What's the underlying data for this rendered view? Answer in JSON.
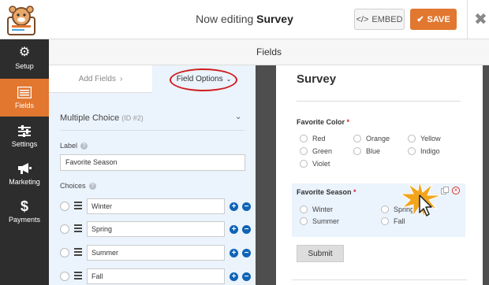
{
  "header": {
    "editing_prefix": "Now editing",
    "form_name": "Survey",
    "embed_label": "EMBED",
    "save_label": "SAVE"
  },
  "sidebar": {
    "items": [
      {
        "label": "Setup",
        "icon": "gear-icon",
        "active": false
      },
      {
        "label": "Fields",
        "icon": "list-icon",
        "active": true
      },
      {
        "label": "Settings",
        "icon": "sliders-icon",
        "active": false
      },
      {
        "label": "Marketing",
        "icon": "megaphone-icon",
        "active": false
      },
      {
        "label": "Payments",
        "icon": "dollar-icon",
        "active": false
      }
    ]
  },
  "panel_title": "Fields",
  "tabs": {
    "add_fields": "Add Fields",
    "field_options": "Field Options"
  },
  "field": {
    "type": "Multiple Choice",
    "id_text": "(ID #2)",
    "label_caption": "Label",
    "label_value": "Favorite Season",
    "choices_caption": "Choices",
    "choices": [
      "Winter",
      "Spring",
      "Summer",
      "Fall"
    ]
  },
  "preview": {
    "title": "Survey",
    "color_field": {
      "label": "Favorite Color",
      "options": [
        "Red",
        "Orange",
        "Yellow",
        "Green",
        "Blue",
        "Indigo",
        "Violet"
      ]
    },
    "season_field": {
      "label": "Favorite Season",
      "options": [
        "Winter",
        "Spring",
        "Summer",
        "Fall"
      ]
    },
    "submit_label": "Submit"
  },
  "colors": {
    "accent_orange": "#e27730",
    "sidebar_bg": "#2d2d2d",
    "panel_blue": "#ebf3fc",
    "highlight_red": "#d01c1c",
    "button_blue": "#0e63b6"
  }
}
